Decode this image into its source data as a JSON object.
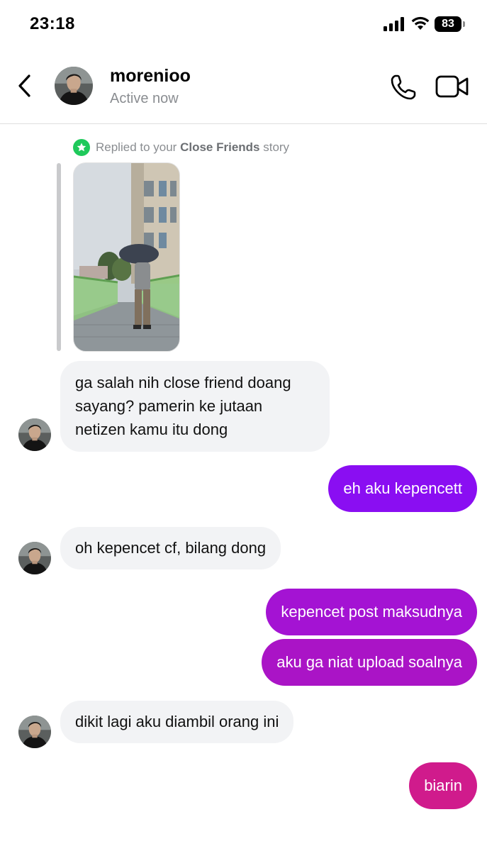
{
  "status_bar": {
    "time": "23:18",
    "battery": "83"
  },
  "header": {
    "name": "morenioo",
    "status": "Active now"
  },
  "story_reply": {
    "prefix": "Replied to your ",
    "list_name": "Close Friends",
    "suffix": " story"
  },
  "messages": [
    {
      "side": "in",
      "lines": [
        "ga salah nih close friend doang",
        "sayang? pamerin ke jutaan",
        "netizen kamu itu dong"
      ]
    },
    {
      "side": "out",
      "text": "eh aku kepencett"
    },
    {
      "side": "in",
      "text": "oh kepencet cf, bilang dong"
    },
    {
      "side": "out",
      "text": "kepencet post maksudnya"
    },
    {
      "side": "out",
      "text": "aku ga niat upload soalnya"
    },
    {
      "side": "in",
      "text": "dikit lagi aku diambil orang ini"
    },
    {
      "side": "out",
      "text": "biarin"
    }
  ],
  "icons": {
    "back": "chevron-left-icon",
    "call": "phone-icon",
    "video": "video-camera-icon",
    "close_friends": "star-badge-icon"
  },
  "colors": {
    "bubble_in": "#f2f3f5",
    "out_1": "#8a0ef2",
    "out_2": "#a413d3",
    "out_3": "#aa14c6",
    "out_4": "#d01b8c",
    "close_friends_green": "#1fc95b"
  }
}
